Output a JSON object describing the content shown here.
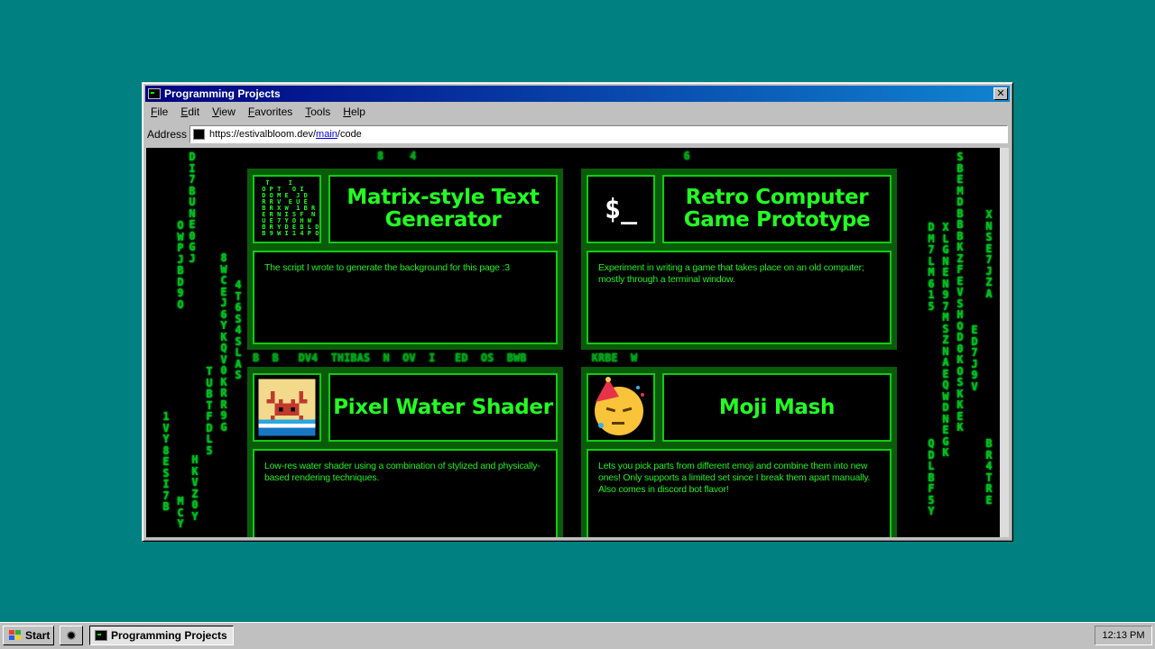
{
  "window": {
    "title": "Programming Projects",
    "close_label": "✕"
  },
  "menu": {
    "items": [
      {
        "underline": "F",
        "rest": "ile"
      },
      {
        "underline": "E",
        "rest": "dit"
      },
      {
        "underline": "V",
        "rest": "iew"
      },
      {
        "underline": "F",
        "rest": "avorites",
        "prefix": ""
      },
      {
        "underline": "T",
        "rest": "ools"
      },
      {
        "underline": "H",
        "rest": "elp"
      }
    ]
  },
  "address": {
    "label": "Address",
    "url_prefix": "https://estivalbloom.dev/",
    "url_link": "main",
    "url_suffix": "/code"
  },
  "projects": [
    {
      "title": "Matrix-style Text Generator",
      "description": "The script I wrote to generate the background for this page :3",
      "thumb": "matrix-thumbnail"
    },
    {
      "title": "Retro Computer Game Prototype",
      "description": "Experiment in writing a game that takes place on an old computer; mostly through a terminal window.",
      "thumb": "terminal-thumbnail",
      "thumb_text": "$_"
    },
    {
      "title": "Pixel Water Shader",
      "description": "Low-res water shader using a combination of stylized and physically-based rendering techniques.",
      "thumb": "pixel-crab-thumbnail"
    },
    {
      "title": "Moji Mash",
      "description": "Lets you pick parts from different emoji and combine them into new ones! Only supports a limited set since I break them apart manually. Also comes in discord bot flavor!",
      "thumb": "emoji-thumbnail"
    }
  ],
  "matrix_rain": {
    "columns": [
      {
        "text": "DI7BUNE0GJ"
      },
      {
        "text": "OWPJBD9O"
      },
      {
        "text": "8WCEJ6YKQV0KRR9G"
      },
      {
        "text": "4T6S4SLAS"
      },
      {
        "text": "TUBTFDL5"
      },
      {
        "text": "1VY8ESI7B"
      },
      {
        "text": "HKVZ0Y"
      },
      {
        "text": "MCY"
      },
      {
        "text": "DM7LM615"
      },
      {
        "text": "XLGNEN97MSZNAEQWDNEGK"
      },
      {
        "text": "SBEMDBBBKZFEVSHOD0KOSKKEK"
      },
      {
        "text": "XNSE7JZA"
      },
      {
        "text": "ED7J9V"
      },
      {
        "text": "QDLBF5Y"
      },
      {
        "text": "BR4TRE"
      }
    ],
    "row": "B  B   DV4  THIBAS  N  OV  I   ED  OS  BWB          KRBE  W",
    "top_row": "8    4                                         6",
    "thumb_text": "  T     I\n O P T   O I\n D O M E  J D\n R R V  E U E\n B R X W  1 B R\n E R N I S F  N\n U E 7 Y O H W\n B R Y D E B L D\n B 9 W I 1 4 P O"
  },
  "taskbar": {
    "start_label": "Start",
    "task_label": "Programming Projects",
    "clock": "12:13 PM"
  }
}
